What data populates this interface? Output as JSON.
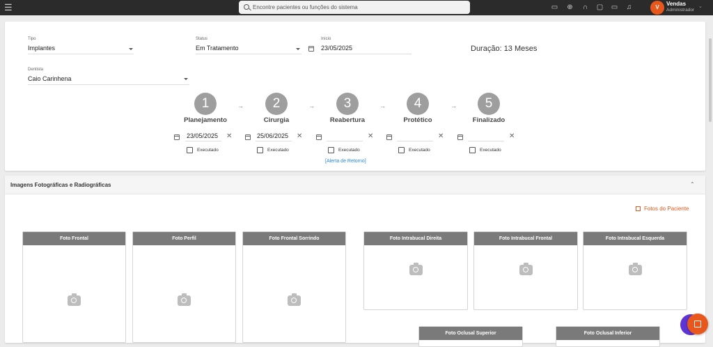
{
  "topbar": {
    "search_placeholder": "Encontre pacientes ou funções do sistema",
    "icons": [
      "video-icon",
      "crosshair-icon",
      "headset-icon",
      "cast-icon",
      "chat-icon",
      "bell-icon"
    ],
    "user": {
      "initial": "V",
      "name": "Vendas",
      "role": "Administrador"
    }
  },
  "form": {
    "tipo": {
      "label": "Tipo",
      "value": "Implantes"
    },
    "status": {
      "label": "Status",
      "value": "Em Tratamento"
    },
    "inicio": {
      "label": "Início",
      "value": "23/05/2025"
    },
    "duracao": "Duração: 13 Meses",
    "dentista": {
      "label": "Dentista",
      "value": "Caio Carinhena"
    }
  },
  "steps": [
    {
      "number": "1",
      "title": "Planejamento",
      "date": "23/05/2025",
      "executed_label": "Executado"
    },
    {
      "number": "2",
      "title": "Cirurgia",
      "date": "25/06/2025",
      "executed_label": "Executado"
    },
    {
      "number": "3",
      "title": "Reabertura",
      "date": "",
      "executed_label": "Executado"
    },
    {
      "number": "4",
      "title": "Protético",
      "date": "",
      "executed_label": "Executado"
    },
    {
      "number": "5",
      "title": "Finalizado",
      "date": "",
      "executed_label": "Executado"
    }
  ],
  "alerta_link": "[Alerta de Retorno]",
  "section": {
    "title": "Imagens Fotográficas e Radiográficas",
    "fotos_button": "Fotos do Paciente"
  },
  "photos": [
    "Foto Frontal",
    "Foto Perfil",
    "Foto Frontal Sorrindo",
    "Foto Intrabucal Direita",
    "Foto Intrabucal Frontal",
    "Foto Intrabucal Esquerda",
    "Foto Oclusal Superior",
    "Foto Oclusal Inferior"
  ],
  "colors": {
    "accent": "#e8581c",
    "fab_secondary": "#5c35d4",
    "link": "#1e88e5"
  }
}
